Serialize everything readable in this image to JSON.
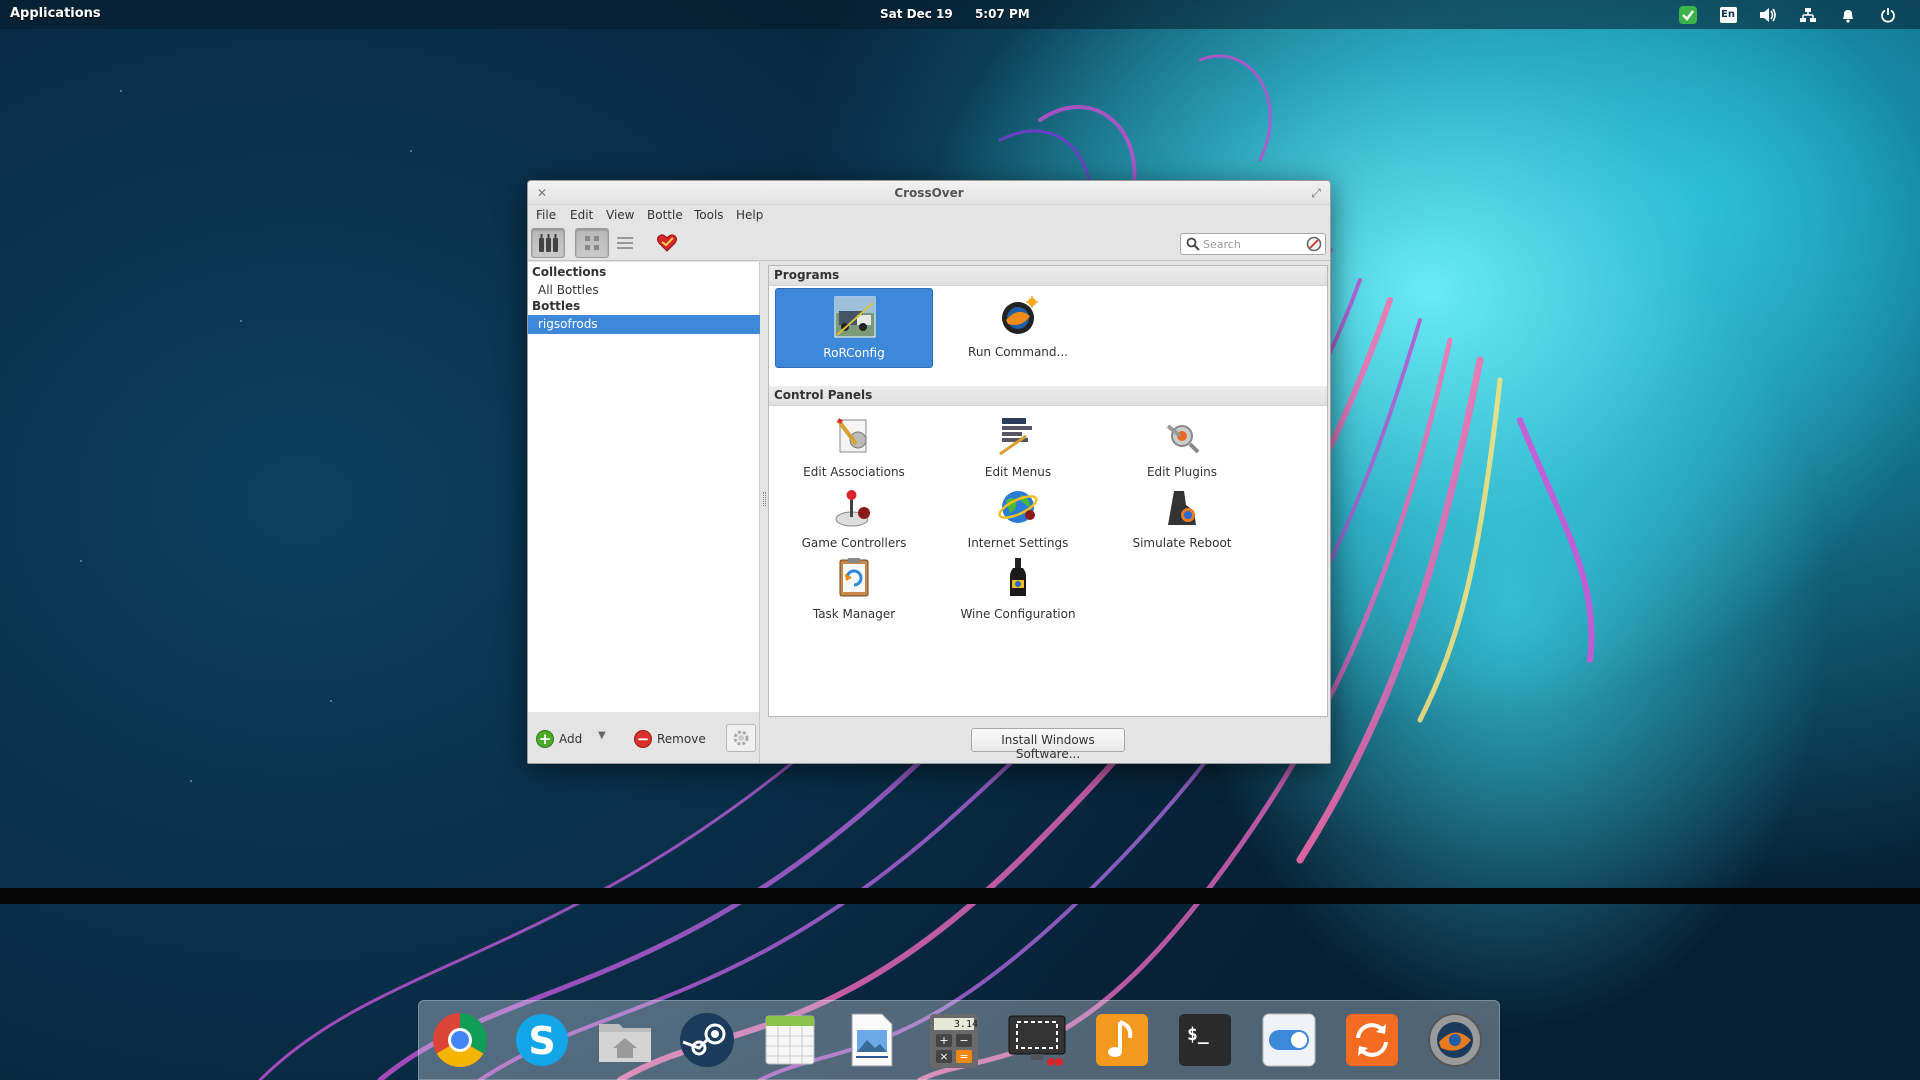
{
  "top_panel": {
    "applications_label": "Applications",
    "date": "Sat Dec 19",
    "time": "5:07 PM",
    "keyboard_layout": "En"
  },
  "window": {
    "title": "CrossOver",
    "menu": [
      "File",
      "Edit",
      "View",
      "Bottle",
      "Tools",
      "Help"
    ],
    "search_placeholder": "Search",
    "sidebar": {
      "collections_header": "Collections",
      "all_bottles": "All Bottles",
      "bottles_header": "Bottles",
      "bottle_name": "rigsofrods"
    },
    "footer": {
      "add_label": "Add",
      "remove_label": "Remove"
    },
    "programs_header": "Programs",
    "programs": [
      {
        "label": "RoRConfig",
        "icon": "rorconfig-icon"
      },
      {
        "label": "Run Command...",
        "icon": "run-command-icon"
      }
    ],
    "control_panels_header": "Control Panels",
    "control_panels": [
      {
        "label": "Edit Associations",
        "icon": "edit-associations-icon"
      },
      {
        "label": "Edit Menus",
        "icon": "edit-menus-icon"
      },
      {
        "label": "Edit Plugins",
        "icon": "edit-plugins-icon"
      },
      {
        "label": "Game Controllers",
        "icon": "joystick-icon"
      },
      {
        "label": "Internet Settings",
        "icon": "internet-settings-icon"
      },
      {
        "label": "Simulate Reboot",
        "icon": "simulate-reboot-icon"
      },
      {
        "label": "Task Manager",
        "icon": "task-manager-icon"
      },
      {
        "label": "Wine Configuration",
        "icon": "wine-configuration-icon"
      }
    ],
    "install_button": "Install Windows Software..."
  },
  "dock": {
    "calculator_display": "3.14",
    "items": [
      "chrome-icon",
      "skype-icon",
      "home-folder-icon",
      "steam-icon",
      "calendar-icon",
      "image-viewer-icon",
      "calculator-icon",
      "screenshot-icon",
      "music-icon",
      "terminal-icon",
      "switchboard-icon",
      "software-update-icon",
      "crossover-icon"
    ]
  },
  "colors": {
    "selection": "#3d88d9",
    "add_green": "#4caa2a",
    "remove_red": "#d9322a"
  }
}
